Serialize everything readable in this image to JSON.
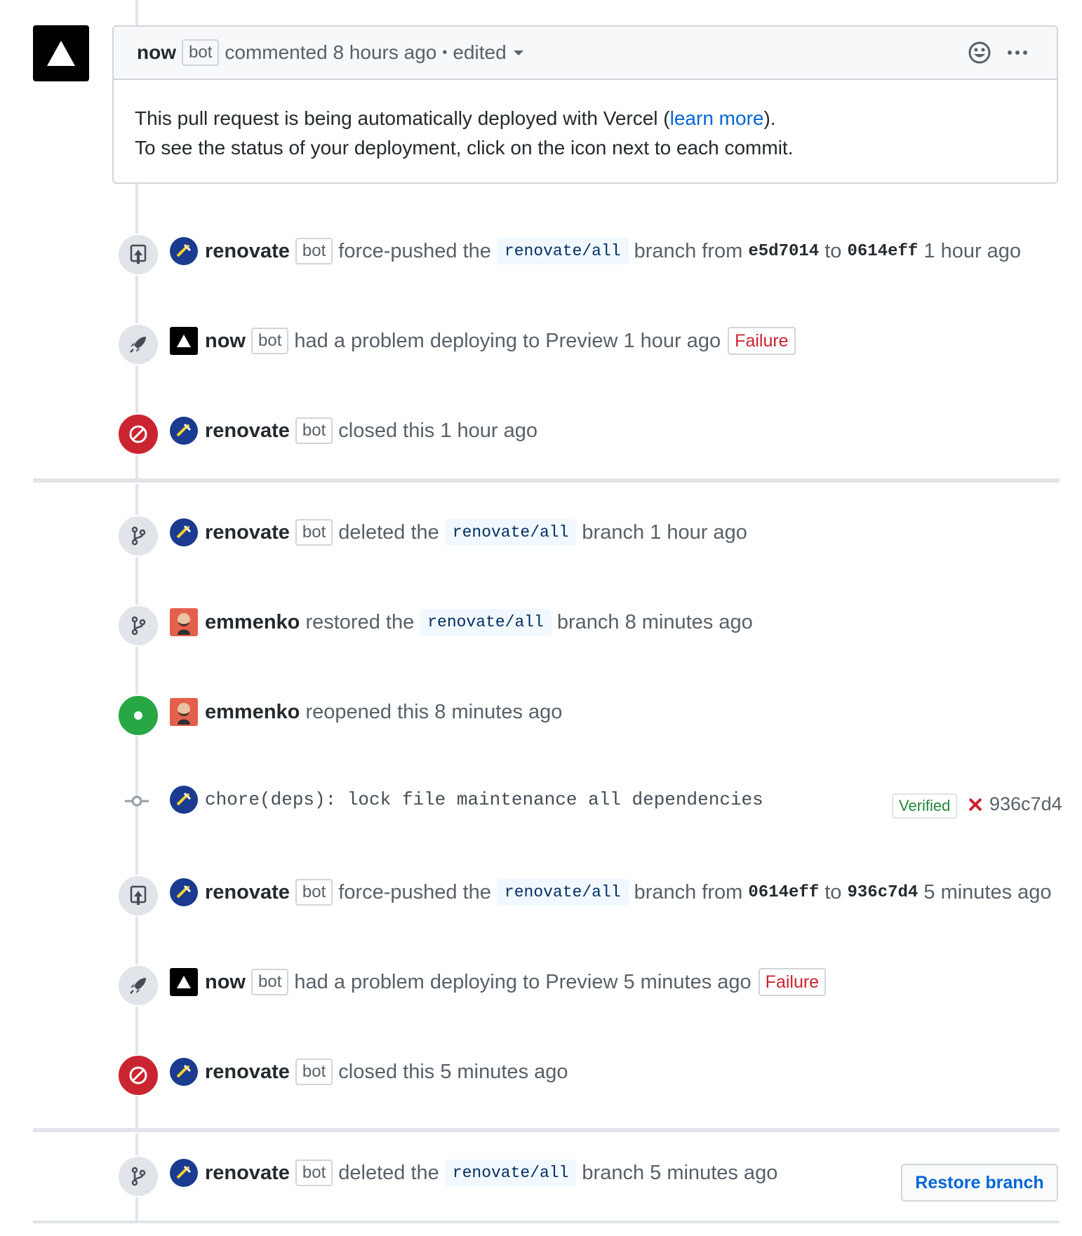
{
  "comment": {
    "author": "now",
    "badge": "bot",
    "action": "commented 8 hours ago",
    "dot": "•",
    "edited": "edited",
    "body_line1_pre": "This pull request is being automatically deployed with Vercel (",
    "body_link": "learn more",
    "body_line1_post": ").",
    "body_line2": "To see the status of your deployment, click on the icon next to each commit.",
    "icons": [
      "smiley-icon",
      "ellipsis-icon"
    ]
  },
  "events": [
    {
      "actor": "renovate",
      "badge": "bot",
      "t1": "force-pushed the",
      "branch": "renovate/all",
      "t2": "branch from",
      "sha1": "e5d7014",
      "t3": "to",
      "sha2": "0614eff",
      "t4": "1 hour ago"
    },
    {
      "actor": "now",
      "badge": "bot",
      "t1": "had a problem deploying to Preview 1 hour ago",
      "status": "Failure"
    },
    {
      "actor": "renovate",
      "badge": "bot",
      "t1": "closed this 1 hour ago"
    },
    {
      "actor": "renovate",
      "badge": "bot",
      "t1": "deleted the",
      "branch": "renovate/all",
      "t2": "branch 1 hour ago"
    },
    {
      "actor": "emmenko",
      "t1": "restored the",
      "branch": "renovate/all",
      "t2": "branch 8 minutes ago"
    },
    {
      "actor": "emmenko",
      "t1": "reopened this 8 minutes ago"
    },
    {
      "message": "chore(deps): lock file maintenance all dependencies",
      "verified": "Verified",
      "status_icon": "x-icon",
      "sha": "936c7d4"
    },
    {
      "actor": "renovate",
      "badge": "bot",
      "t1": "force-pushed the",
      "branch": "renovate/all",
      "t2": "branch from",
      "sha1": "0614eff",
      "t3": "to",
      "sha2": "936c7d4",
      "t4": "5 minutes ago"
    },
    {
      "actor": "now",
      "badge": "bot",
      "t1": "had a problem deploying to Preview 5 minutes ago",
      "status": "Failure"
    },
    {
      "actor": "renovate",
      "badge": "bot",
      "t1": "closed this 5 minutes ago"
    },
    {
      "actor": "renovate",
      "badge": "bot",
      "t1": "deleted the",
      "branch": "renovate/all",
      "t2": "branch 5 minutes ago"
    }
  ],
  "restore_button": "Restore branch",
  "colors": {
    "link": "#0366d6",
    "danger": "#cb2431",
    "success": "#28a745",
    "border": "#d1d5da"
  }
}
